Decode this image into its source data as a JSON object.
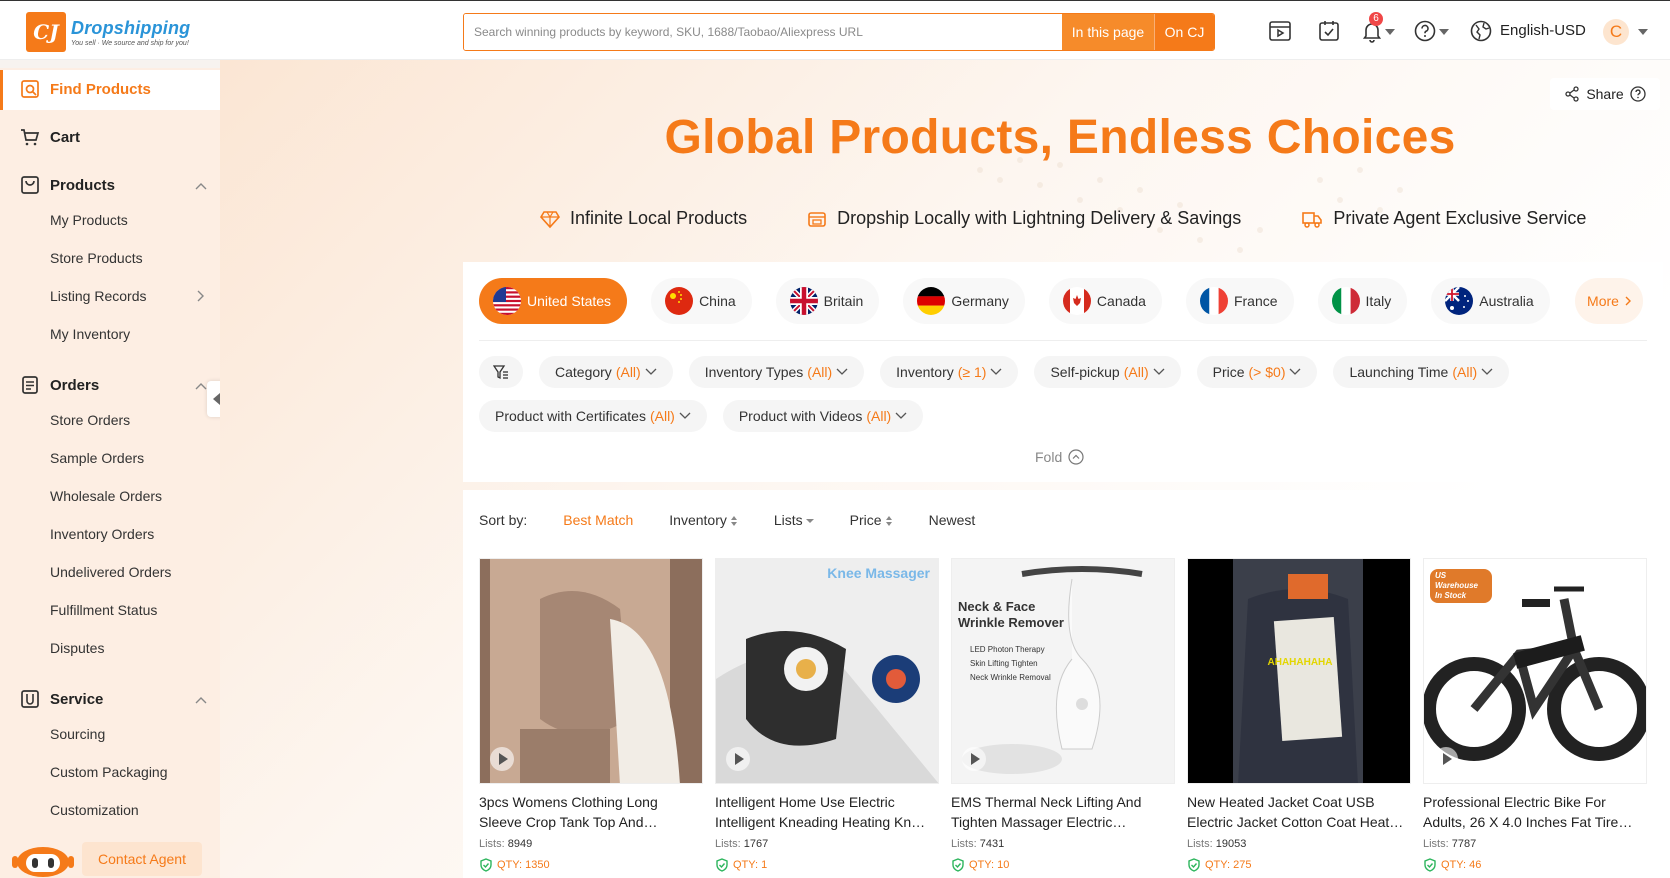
{
  "header": {
    "logo_mark": "CJ",
    "logo_title": "Dropshipping",
    "logo_tagline": "You sell · We source and ship for you!",
    "search_placeholder": "Search winning products by keyword, SKU, 1688/Taobao/Aliexpress URL",
    "search_in_page": "In this page",
    "search_on_cj": "On CJ",
    "notification_count": "6",
    "language": "English-USD",
    "avatar_letter": "C"
  },
  "sidebar": {
    "find_products": "Find Products",
    "cart": "Cart",
    "products": {
      "label": "Products",
      "items": [
        "My Products",
        "Store Products",
        "Listing Records",
        "My Inventory"
      ]
    },
    "orders": {
      "label": "Orders",
      "items": [
        "Store Orders",
        "Sample Orders",
        "Wholesale Orders",
        "Inventory Orders",
        "Undelivered Orders",
        "Fulfillment Status",
        "Disputes"
      ]
    },
    "service": {
      "label": "Service",
      "items": [
        "Sourcing",
        "Custom Packaging",
        "Customization"
      ]
    },
    "contact_agent": "Contact Agent"
  },
  "main": {
    "share": "Share",
    "hero_title": "Global Products, Endless Choices",
    "features": [
      "Infinite Local Products",
      "Dropship Locally with Lightning Delivery & Savings",
      "Private Agent Exclusive Service"
    ],
    "countries": [
      "United States",
      "China",
      "Britain",
      "Germany",
      "Canada",
      "France",
      "Italy",
      "Australia"
    ],
    "more": "More",
    "filters": [
      {
        "label": "Category",
        "value": "(All)"
      },
      {
        "label": "Inventory Types",
        "value": "(All)"
      },
      {
        "label": "Inventory",
        "value": "(≥ 1)"
      },
      {
        "label": "Self-pickup",
        "value": "(All)"
      },
      {
        "label": "Price",
        "value": "(> $0)"
      },
      {
        "label": "Launching Time",
        "value": "(All)"
      },
      {
        "label": "Product with Certificates",
        "value": "(All)"
      },
      {
        "label": "Product with Videos",
        "value": "(All)"
      }
    ],
    "fold": "Fold",
    "sort": {
      "label": "Sort by:",
      "options": [
        "Best Match",
        "Inventory",
        "Lists",
        "Price",
        "Newest"
      ]
    },
    "products": [
      {
        "title": "3pcs Womens Clothing Long Sleeve Crop Tank Top And…",
        "lists_label": "Lists:",
        "lists": "8949",
        "qty": "QTY: 1350"
      },
      {
        "title": "Intelligent Home Use Electric Intelligent Kneading Heating Kn…",
        "lists_label": "Lists:",
        "lists": "1767",
        "qty": "QTY: 1",
        "img_text": "Knee Massager"
      },
      {
        "title": "EMS Thermal Neck Lifting And Tighten Massager Electric…",
        "lists_label": "Lists:",
        "lists": "7431",
        "qty": "QTY: 10",
        "img_text": "Neck & Face Wrinkle Remover",
        "img_items": [
          "LED Photon Therapy",
          "Skin Lifting Tighten",
          "Neck Wrinkle Removal"
        ]
      },
      {
        "title": "New Heated Jacket Coat USB Electric Jacket Cotton Coat Heat…",
        "lists_label": "Lists:",
        "lists": "19053",
        "qty": "QTY: 275",
        "img_text": "AHAHAHAHA"
      },
      {
        "title": "Professional Electric Bike For Adults, 26 X 4.0 Inches Fat Tire…",
        "lists_label": "Lists:",
        "lists": "7787",
        "qty": "QTY: 46",
        "img_text": "US Warehouse In Stock"
      }
    ]
  },
  "colors": {
    "accent": "#f57a19",
    "brand_blue": "#2a94d8"
  }
}
